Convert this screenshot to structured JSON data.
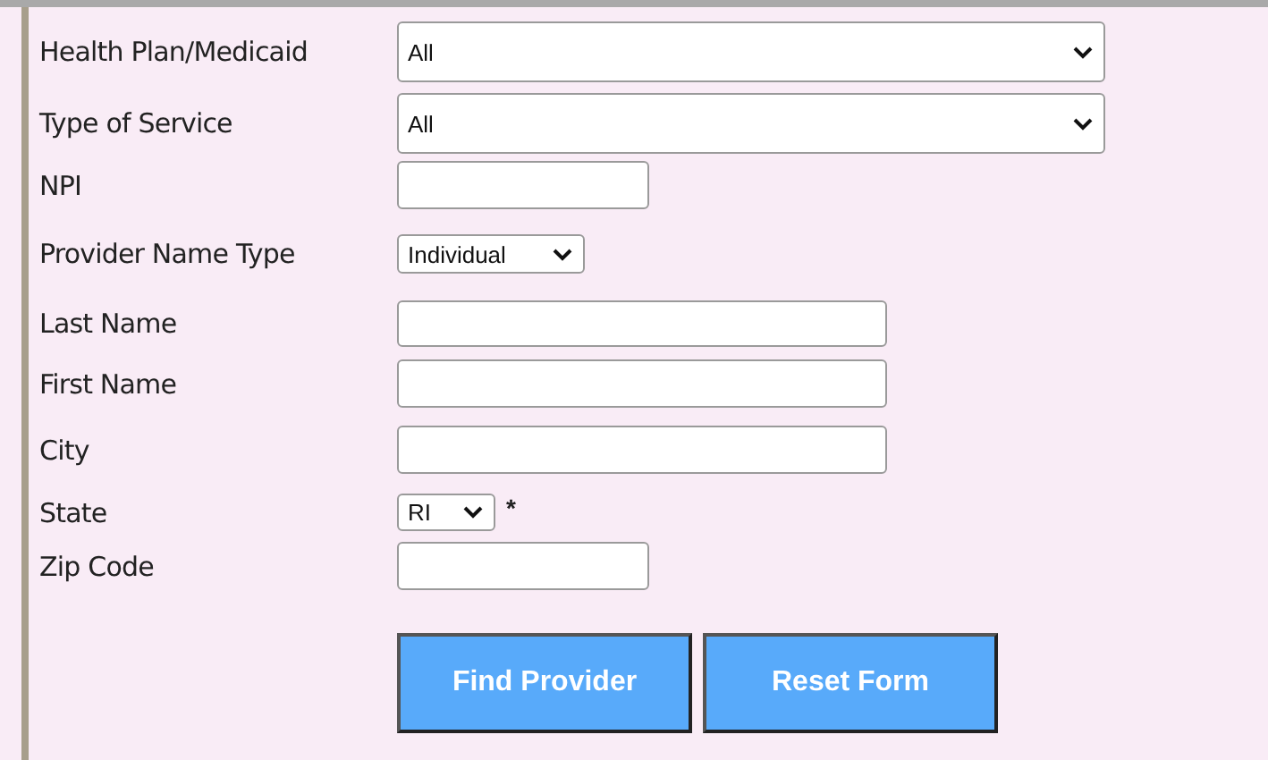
{
  "form": {
    "fields": [
      {
        "label": "Health Plan/Medicaid",
        "kind": "select",
        "value": "All"
      },
      {
        "label": "Type of Service",
        "kind": "select",
        "value": "All"
      },
      {
        "label": "NPI",
        "kind": "text"
      },
      {
        "label": "Provider Name Type",
        "kind": "select",
        "value": "Individual"
      },
      {
        "label": "Last Name",
        "kind": "text"
      },
      {
        "label": "First Name",
        "kind": "text"
      },
      {
        "label": "City",
        "kind": "text"
      },
      {
        "label": "State",
        "kind": "select",
        "value": "RI",
        "note": "*"
      },
      {
        "label": "Zip Code",
        "kind": "text"
      }
    ]
  },
  "buttons": [
    "Find Provider",
    "Reset Form"
  ]
}
